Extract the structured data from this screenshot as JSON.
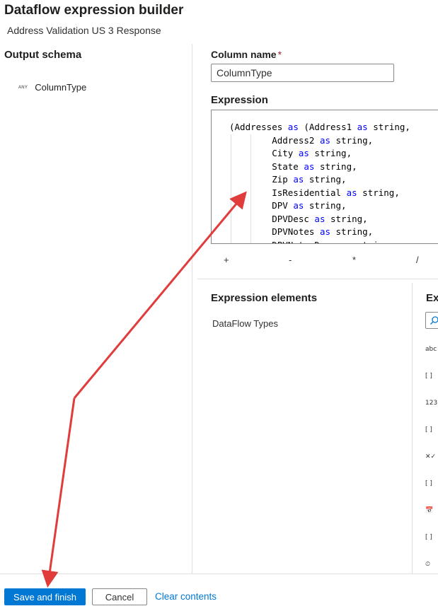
{
  "dialog": {
    "title": "Dataflow expression builder",
    "subtitle": "Address Validation US 3 Response"
  },
  "output_schema": {
    "title": "Output schema",
    "items": [
      {
        "type": "ANY",
        "name": "ColumnType"
      }
    ]
  },
  "column": {
    "label": "Column name",
    "required_mark": "*",
    "value": "ColumnType"
  },
  "expression": {
    "label": "Expression",
    "lines": [
      [
        {
          "t": "(Addresses "
        },
        {
          "t": "as",
          "k": 1
        },
        {
          "t": " (Address1 "
        },
        {
          "t": "as",
          "k": 1
        },
        {
          "t": " string,"
        }
      ],
      [
        {
          "t": "        Address2 "
        },
        {
          "t": "as",
          "k": 1
        },
        {
          "t": " string,"
        }
      ],
      [
        {
          "t": "        City "
        },
        {
          "t": "as",
          "k": 1
        },
        {
          "t": " string,"
        }
      ],
      [
        {
          "t": "        State "
        },
        {
          "t": "as",
          "k": 1
        },
        {
          "t": " string,"
        }
      ],
      [
        {
          "t": "        Zip "
        },
        {
          "t": "as",
          "k": 1
        },
        {
          "t": " string,"
        }
      ],
      [
        {
          "t": "        IsResidential "
        },
        {
          "t": "as",
          "k": 1
        },
        {
          "t": " string,"
        }
      ],
      [
        {
          "t": "        DPV "
        },
        {
          "t": "as",
          "k": 1
        },
        {
          "t": " string,"
        }
      ],
      [
        {
          "t": "        DPVDesc "
        },
        {
          "t": "as",
          "k": 1
        },
        {
          "t": " string,"
        }
      ],
      [
        {
          "t": "        DPVNotes "
        },
        {
          "t": "as",
          "k": 1
        },
        {
          "t": " string,"
        }
      ],
      [
        {
          "t": "        DPVNotesDesc "
        },
        {
          "t": "as",
          "k": 1
        },
        {
          "t": " string,"
        }
      ]
    ],
    "operators": [
      "+",
      "-",
      "*",
      "/"
    ]
  },
  "elements": {
    "title": "Expression elements",
    "items": [
      "DataFlow Types"
    ]
  },
  "values_panel": {
    "title": "Exp",
    "icons": [
      {
        "name": "string-type-icon",
        "glyph": "abc"
      },
      {
        "name": "array-icon",
        "glyph": "[ ]"
      },
      {
        "name": "integer-type-icon",
        "glyph": "123"
      },
      {
        "name": "array-icon",
        "glyph": "[ ]"
      },
      {
        "name": "boolean-type-icon",
        "glyph": "✕✓"
      },
      {
        "name": "array-icon",
        "glyph": "[ ]"
      },
      {
        "name": "date-type-icon",
        "glyph": "📅"
      },
      {
        "name": "array-icon",
        "glyph": "[ ]"
      },
      {
        "name": "timestamp-type-icon",
        "glyph": "⏲"
      }
    ]
  },
  "footer": {
    "save": "Save and finish",
    "cancel": "Cancel",
    "clear": "Clear contents"
  },
  "colors": {
    "primary": "#0078d4",
    "keyword": "#0000ff",
    "annotation_arrow": "#e03c3c"
  }
}
